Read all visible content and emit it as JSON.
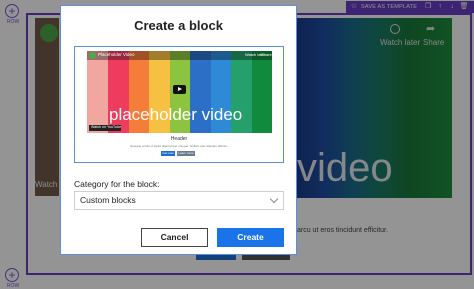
{
  "toolbar": {
    "save_template_label": "SAVE AS TEMPLATE",
    "icons": [
      "star-icon",
      "copy-icon",
      "arrow-up-icon",
      "arrow-down-icon",
      "delete-icon"
    ]
  },
  "editor": {
    "add_row_label": "ROW",
    "watch_later": "Watch later",
    "share": "Share",
    "watch_left": "Watch",
    "video_word": "video",
    "body_text": "arcu ut eros tincidunt efficitur."
  },
  "modal": {
    "title": "Create a block",
    "preview": {
      "channel_title": "Placeholder Video",
      "watch_later": "Watch later",
      "share": "Share",
      "video_text": "placeholder video",
      "watch_on": "Watch on YouTube",
      "header": "Header",
      "body": "Quisque a felis ut ligula ullamcorper congue. Nullam quis aliquam efficitur.",
      "button_a": "Get now",
      "button_b": "Learn more",
      "stripe_colors": [
        "#f2a6a0",
        "#ee3b5e",
        "#f57d3a",
        "#f6c143",
        "#8cc43f",
        "#2c6fc7",
        "#2e8ad6",
        "#26a06a",
        "#128a3e"
      ]
    },
    "category_label": "Category for the block:",
    "category_value": "Custom blocks",
    "cancel_label": "Cancel",
    "create_label": "Create"
  },
  "colors": {
    "accent_purple": "#6a3fc7",
    "primary_blue": "#1a73e8"
  }
}
